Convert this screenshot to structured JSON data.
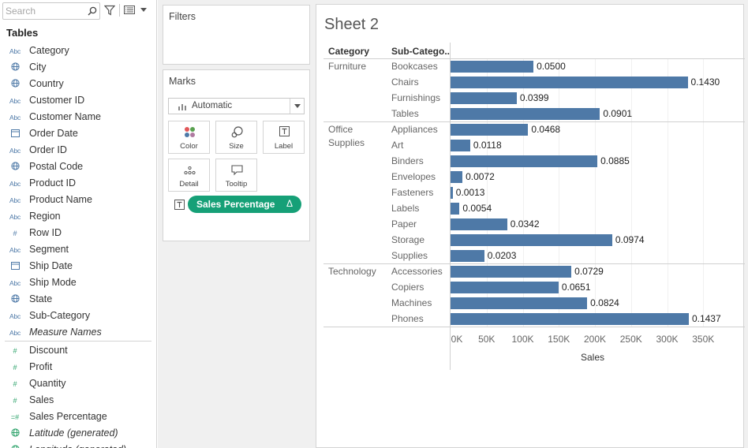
{
  "data_pane": {
    "search": {
      "placeholder": "Search"
    },
    "tables_title": "Tables",
    "dimensions": [
      {
        "name": "Category",
        "type": "abc"
      },
      {
        "name": "City",
        "type": "globe"
      },
      {
        "name": "Country",
        "type": "globe"
      },
      {
        "name": "Customer ID",
        "type": "abc"
      },
      {
        "name": "Customer Name",
        "type": "abc"
      },
      {
        "name": "Order Date",
        "type": "date"
      },
      {
        "name": "Order ID",
        "type": "abc"
      },
      {
        "name": "Postal Code",
        "type": "globe"
      },
      {
        "name": "Product ID",
        "type": "abc"
      },
      {
        "name": "Product Name",
        "type": "abc"
      },
      {
        "name": "Region",
        "type": "abc"
      },
      {
        "name": "Row ID",
        "type": "hash"
      },
      {
        "name": "Segment",
        "type": "abc"
      },
      {
        "name": "Ship Date",
        "type": "date"
      },
      {
        "name": "Ship Mode",
        "type": "abc"
      },
      {
        "name": "State",
        "type": "globe"
      },
      {
        "name": "Sub-Category",
        "type": "abc"
      },
      {
        "name": "Measure Names",
        "type": "abc",
        "italic": true
      }
    ],
    "measures": [
      {
        "name": "Discount",
        "type": "hash"
      },
      {
        "name": "Profit",
        "type": "hash"
      },
      {
        "name": "Quantity",
        "type": "hash"
      },
      {
        "name": "Sales",
        "type": "hash"
      },
      {
        "name": "Sales Percentage",
        "type": "calc-hash"
      },
      {
        "name": "Latitude (generated)",
        "type": "globe",
        "italic": true
      },
      {
        "name": "Longitude (generated)",
        "type": "globe",
        "italic": true
      }
    ]
  },
  "filters_card": {
    "title": "Filters"
  },
  "marks_card": {
    "title": "Marks",
    "mark_type": "Automatic",
    "buttons": [
      "Color",
      "Size",
      "Label",
      "Detail",
      "Tooltip"
    ],
    "pill": {
      "label": "Sales Percentage",
      "delta": "Δ"
    }
  },
  "sheet": {
    "title": "Sheet 2",
    "col_headers": [
      "Category",
      "Sub-Catego.."
    ]
  },
  "colors": {
    "bar": "#4e79a7",
    "pill": "#16a077"
  },
  "chart_data": {
    "type": "bar",
    "orientation": "horizontal",
    "xlabel": "Sales",
    "xlim": [
      0,
      380000
    ],
    "x_ticks": [
      "0K",
      "50K",
      "100K",
      "150K",
      "200K",
      "250K",
      "300K",
      "350K"
    ],
    "groups": [
      {
        "category": [
          "Furniture"
        ],
        "items": [
          {
            "sub": "Bookcases",
            "sales": 114880,
            "label": "0.0500"
          },
          {
            "sub": "Chairs",
            "sales": 328449,
            "label": "0.1430"
          },
          {
            "sub": "Furnishings",
            "sales": 91705,
            "label": "0.0399"
          },
          {
            "sub": "Tables",
            "sales": 206966,
            "label": "0.0901"
          }
        ]
      },
      {
        "category": [
          "Office",
          "Supplies"
        ],
        "items": [
          {
            "sub": "Appliances",
            "sales": 107532,
            "label": "0.0468"
          },
          {
            "sub": "Art",
            "sales": 27119,
            "label": "0.0118"
          },
          {
            "sub": "Binders",
            "sales": 203413,
            "label": "0.0885"
          },
          {
            "sub": "Envelopes",
            "sales": 16476,
            "label": "0.0072"
          },
          {
            "sub": "Fasteners",
            "sales": 3024,
            "label": "0.0013"
          },
          {
            "sub": "Labels",
            "sales": 12486,
            "label": "0.0054"
          },
          {
            "sub": "Paper",
            "sales": 78479,
            "label": "0.0342"
          },
          {
            "sub": "Storage",
            "sales": 223844,
            "label": "0.0974"
          },
          {
            "sub": "Supplies",
            "sales": 46674,
            "label": "0.0203"
          }
        ]
      },
      {
        "category": [
          "Technology"
        ],
        "items": [
          {
            "sub": "Accessories",
            "sales": 167380,
            "label": "0.0729"
          },
          {
            "sub": "Copiers",
            "sales": 149528,
            "label": "0.0651"
          },
          {
            "sub": "Machines",
            "sales": 189239,
            "label": "0.0824"
          },
          {
            "sub": "Phones",
            "sales": 330007,
            "label": "0.1437"
          }
        ]
      }
    ]
  }
}
